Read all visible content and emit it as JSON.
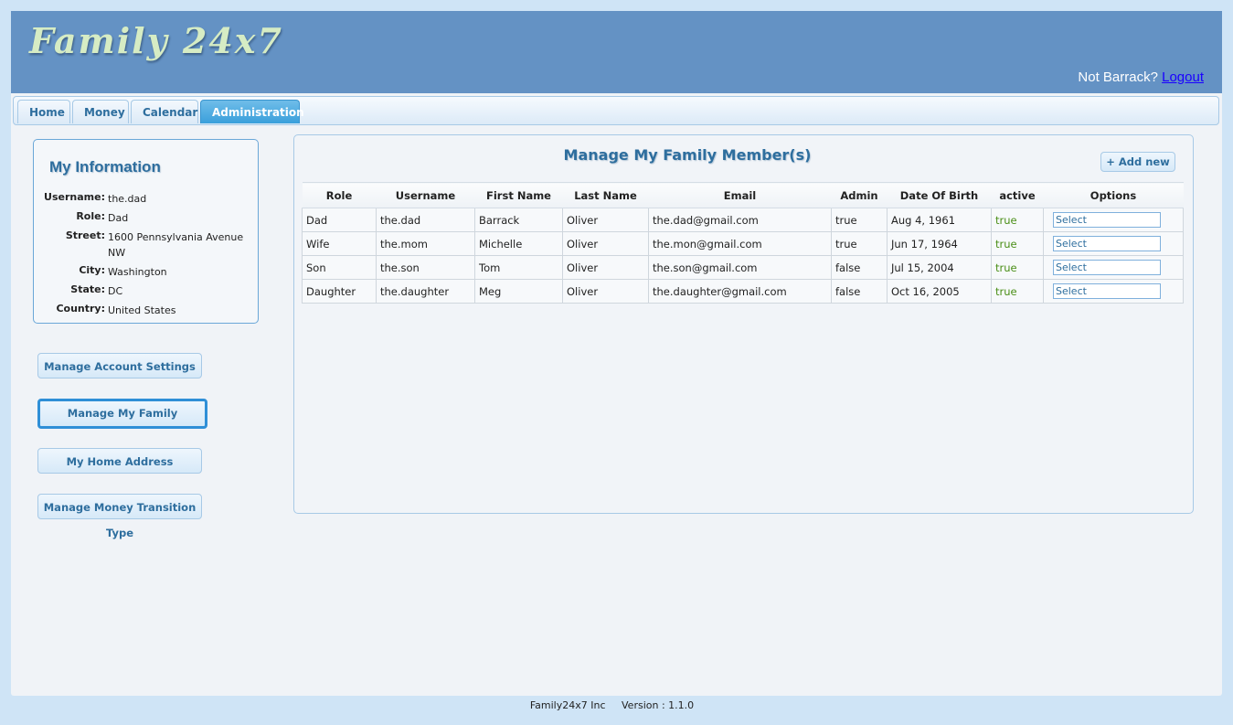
{
  "app": {
    "logo_text": "Family 24x7",
    "user_prompt": "Not Barrack?",
    "logout_label": "Logout"
  },
  "nav": {
    "tabs": [
      {
        "label": "Home"
      },
      {
        "label": "Money"
      },
      {
        "label": "Calendar"
      },
      {
        "label": "Administration",
        "active": true
      }
    ]
  },
  "my_info": {
    "title": "My Information",
    "rows": [
      {
        "label": "Username:",
        "value": "the.dad"
      },
      {
        "label": "Role:",
        "value": "Dad"
      },
      {
        "label": "Street:",
        "value": "1600 Pennsylvania Avenue NW"
      },
      {
        "label": "City:",
        "value": "Washington"
      },
      {
        "label": "State:",
        "value": "DC"
      },
      {
        "label": "Country:",
        "value": "United States"
      }
    ]
  },
  "sidebar": {
    "buttons": [
      {
        "label": "Manage Account Settings"
      },
      {
        "label": "Manage My Family",
        "active": true
      },
      {
        "label": "My Home Address"
      },
      {
        "label": "Manage Money Transition Type"
      }
    ]
  },
  "panel": {
    "title": "Manage My Family Member(s)",
    "add_label": "+ Add new",
    "columns": [
      "Role",
      "Username",
      "First Name",
      "Last Name",
      "Email",
      "Admin",
      "Date Of Birth",
      "active",
      "Options"
    ],
    "rows": [
      [
        "Dad",
        "the.dad",
        "Barrack",
        "Oliver",
        "the.dad@gmail.com",
        "true",
        "Aug 4, 1961",
        "true",
        "Select"
      ],
      [
        "Wife",
        "the.mom",
        "Michelle",
        "Oliver",
        "the.mon@gmail.com",
        "true",
        "Jun 17, 1964",
        "true",
        "Select"
      ],
      [
        "Son",
        "the.son",
        "Tom",
        "Oliver",
        "the.son@gmail.com",
        "false",
        "Jul 15, 2004",
        "true",
        "Select"
      ],
      [
        "Daughter",
        "the.daughter",
        "Meg",
        "Oliver",
        "the.daughter@gmail.com",
        "false",
        "Oct 16, 2005",
        "true",
        "Select"
      ]
    ]
  },
  "footer": {
    "company": "Family24x7 Inc",
    "version": "Version : 1.1.0"
  },
  "colors": {
    "header_bg": "#6492c4",
    "logo": "#d6ecc4",
    "accent": "#2e6e9e",
    "active_tab": "#3a9fdb",
    "active_value": "#4b8f18"
  }
}
